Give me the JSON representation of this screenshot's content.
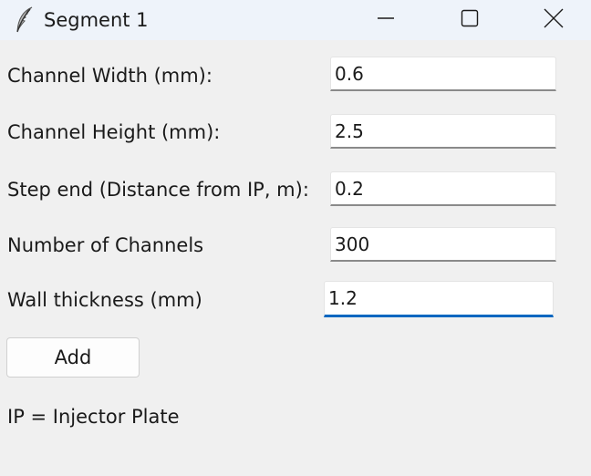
{
  "window": {
    "title": "Segment 1",
    "app_icon": "feather-icon",
    "controls": {
      "minimize_icon": "minimize-icon",
      "maximize_icon": "maximize-icon",
      "close_icon": "close-icon"
    }
  },
  "form": {
    "fields": [
      {
        "label": "Channel Width (mm):",
        "value": "0.6"
      },
      {
        "label": "Channel Height (mm):",
        "value": "2.5"
      },
      {
        "label": "Step end (Distance from IP, m):",
        "value": "0.2"
      },
      {
        "label": "Number of Channels",
        "value": "300"
      },
      {
        "label": "Wall thickness (mm)",
        "value": "1.2",
        "focused": true
      }
    ],
    "add_label": "Add",
    "note": "IP = Injector Plate"
  },
  "colors": {
    "background": "#f0f0f0",
    "titlebar": "#eef3fa",
    "focus_accent": "#0067c0"
  }
}
